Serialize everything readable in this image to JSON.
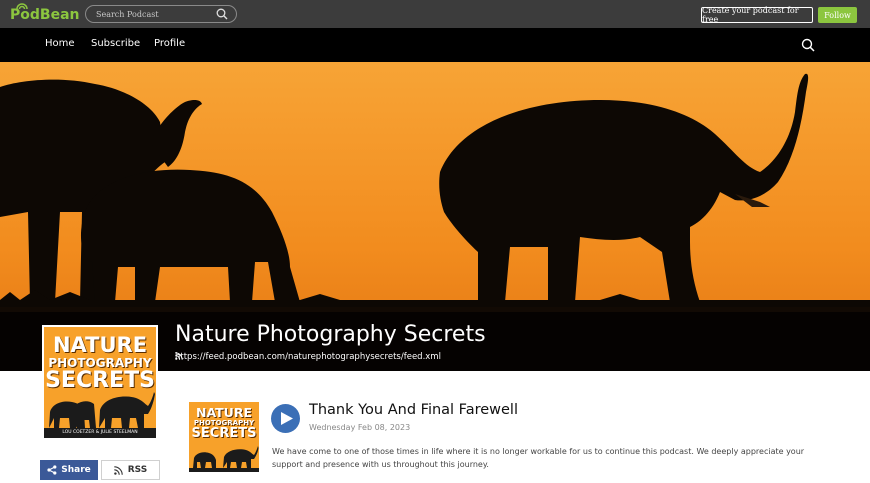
{
  "topbar": {
    "logo_text": "PodBean",
    "search_placeholder": "Search Podcast",
    "create_label": "Create your podcast for free",
    "follow_label": "Follow"
  },
  "nav": {
    "items": [
      {
        "label": "Home"
      },
      {
        "label": "Subscribe"
      },
      {
        "label": "Profile"
      }
    ]
  },
  "podcast": {
    "title": "Nature Photography Secrets",
    "feed_url": "https://feed.podbean.com/naturephotographysecrets/feed.xml",
    "cover": {
      "line1": "NATURE",
      "line2": "PHOTOGRAPHY",
      "line3": "SECRETS",
      "credits": "LOU COETZER & JULIE STEELMAN"
    }
  },
  "actions": {
    "share_label": "Share",
    "rss_label": "RSS"
  },
  "episode": {
    "title": "Thank You And Final Farewell",
    "date": "Wednesday Feb 08, 2023",
    "description": "We have come to one of those times in life where it is no longer workable for us to continue this podcast.  We deeply appreciate your support and presence with us throughout this journey."
  },
  "colors": {
    "brand_green": "#8cc63f",
    "topbar": "#3c3c3c",
    "navbar": "#000000",
    "sky_orange": "#f4921f",
    "share_blue": "#3b5998",
    "play_blue": "#3b6fb6"
  },
  "icons": [
    "podbean-logo-icon",
    "search-icon",
    "rss-icon",
    "share-icon",
    "play-icon"
  ]
}
